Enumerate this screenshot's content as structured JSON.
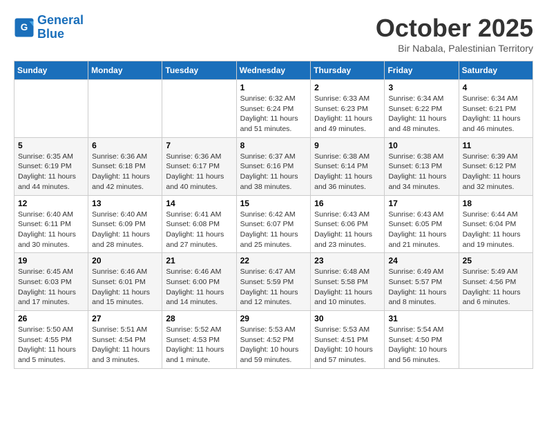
{
  "header": {
    "logo_line1": "General",
    "logo_line2": "Blue",
    "month": "October 2025",
    "location": "Bir Nabala, Palestinian Territory"
  },
  "weekdays": [
    "Sunday",
    "Monday",
    "Tuesday",
    "Wednesday",
    "Thursday",
    "Friday",
    "Saturday"
  ],
  "weeks": [
    [
      {
        "day": "",
        "info": ""
      },
      {
        "day": "",
        "info": ""
      },
      {
        "day": "",
        "info": ""
      },
      {
        "day": "1",
        "info": "Sunrise: 6:32 AM\nSunset: 6:24 PM\nDaylight: 11 hours\nand 51 minutes."
      },
      {
        "day": "2",
        "info": "Sunrise: 6:33 AM\nSunset: 6:23 PM\nDaylight: 11 hours\nand 49 minutes."
      },
      {
        "day": "3",
        "info": "Sunrise: 6:34 AM\nSunset: 6:22 PM\nDaylight: 11 hours\nand 48 minutes."
      },
      {
        "day": "4",
        "info": "Sunrise: 6:34 AM\nSunset: 6:21 PM\nDaylight: 11 hours\nand 46 minutes."
      }
    ],
    [
      {
        "day": "5",
        "info": "Sunrise: 6:35 AM\nSunset: 6:19 PM\nDaylight: 11 hours\nand 44 minutes."
      },
      {
        "day": "6",
        "info": "Sunrise: 6:36 AM\nSunset: 6:18 PM\nDaylight: 11 hours\nand 42 minutes."
      },
      {
        "day": "7",
        "info": "Sunrise: 6:36 AM\nSunset: 6:17 PM\nDaylight: 11 hours\nand 40 minutes."
      },
      {
        "day": "8",
        "info": "Sunrise: 6:37 AM\nSunset: 6:16 PM\nDaylight: 11 hours\nand 38 minutes."
      },
      {
        "day": "9",
        "info": "Sunrise: 6:38 AM\nSunset: 6:14 PM\nDaylight: 11 hours\nand 36 minutes."
      },
      {
        "day": "10",
        "info": "Sunrise: 6:38 AM\nSunset: 6:13 PM\nDaylight: 11 hours\nand 34 minutes."
      },
      {
        "day": "11",
        "info": "Sunrise: 6:39 AM\nSunset: 6:12 PM\nDaylight: 11 hours\nand 32 minutes."
      }
    ],
    [
      {
        "day": "12",
        "info": "Sunrise: 6:40 AM\nSunset: 6:11 PM\nDaylight: 11 hours\nand 30 minutes."
      },
      {
        "day": "13",
        "info": "Sunrise: 6:40 AM\nSunset: 6:09 PM\nDaylight: 11 hours\nand 28 minutes."
      },
      {
        "day": "14",
        "info": "Sunrise: 6:41 AM\nSunset: 6:08 PM\nDaylight: 11 hours\nand 27 minutes."
      },
      {
        "day": "15",
        "info": "Sunrise: 6:42 AM\nSunset: 6:07 PM\nDaylight: 11 hours\nand 25 minutes."
      },
      {
        "day": "16",
        "info": "Sunrise: 6:43 AM\nSunset: 6:06 PM\nDaylight: 11 hours\nand 23 minutes."
      },
      {
        "day": "17",
        "info": "Sunrise: 6:43 AM\nSunset: 6:05 PM\nDaylight: 11 hours\nand 21 minutes."
      },
      {
        "day": "18",
        "info": "Sunrise: 6:44 AM\nSunset: 6:04 PM\nDaylight: 11 hours\nand 19 minutes."
      }
    ],
    [
      {
        "day": "19",
        "info": "Sunrise: 6:45 AM\nSunset: 6:03 PM\nDaylight: 11 hours\nand 17 minutes."
      },
      {
        "day": "20",
        "info": "Sunrise: 6:46 AM\nSunset: 6:01 PM\nDaylight: 11 hours\nand 15 minutes."
      },
      {
        "day": "21",
        "info": "Sunrise: 6:46 AM\nSunset: 6:00 PM\nDaylight: 11 hours\nand 14 minutes."
      },
      {
        "day": "22",
        "info": "Sunrise: 6:47 AM\nSunset: 5:59 PM\nDaylight: 11 hours\nand 12 minutes."
      },
      {
        "day": "23",
        "info": "Sunrise: 6:48 AM\nSunset: 5:58 PM\nDaylight: 11 hours\nand 10 minutes."
      },
      {
        "day": "24",
        "info": "Sunrise: 6:49 AM\nSunset: 5:57 PM\nDaylight: 11 hours\nand 8 minutes."
      },
      {
        "day": "25",
        "info": "Sunrise: 5:49 AM\nSunset: 4:56 PM\nDaylight: 11 hours\nand 6 minutes."
      }
    ],
    [
      {
        "day": "26",
        "info": "Sunrise: 5:50 AM\nSunset: 4:55 PM\nDaylight: 11 hours\nand 5 minutes."
      },
      {
        "day": "27",
        "info": "Sunrise: 5:51 AM\nSunset: 4:54 PM\nDaylight: 11 hours\nand 3 minutes."
      },
      {
        "day": "28",
        "info": "Sunrise: 5:52 AM\nSunset: 4:53 PM\nDaylight: 11 hours\nand 1 minute."
      },
      {
        "day": "29",
        "info": "Sunrise: 5:53 AM\nSunset: 4:52 PM\nDaylight: 10 hours\nand 59 minutes."
      },
      {
        "day": "30",
        "info": "Sunrise: 5:53 AM\nSunset: 4:51 PM\nDaylight: 10 hours\nand 57 minutes."
      },
      {
        "day": "31",
        "info": "Sunrise: 5:54 AM\nSunset: 4:50 PM\nDaylight: 10 hours\nand 56 minutes."
      },
      {
        "day": "",
        "info": ""
      }
    ]
  ]
}
